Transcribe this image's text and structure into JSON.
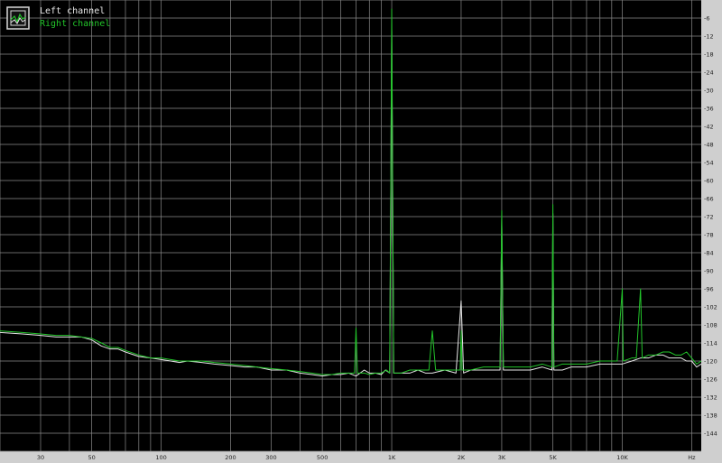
{
  "colors": {
    "background": "#000000",
    "grid": "#8a8a8a",
    "frame": "#cfcfcf",
    "left_channel": "#e6e6e6",
    "right_channel": "#22c42a"
  },
  "legend": {
    "icon": "spectrum-icon",
    "items": [
      {
        "label": "Left channel",
        "color": "#e6e6e6"
      },
      {
        "label": "Right channel",
        "color": "#22c42a"
      }
    ]
  },
  "chart_data": {
    "type": "line",
    "title": "",
    "xlabel": "",
    "ylabel": "",
    "x_scale": "log",
    "xlim": [
      20,
      22000
    ],
    "ylim": [
      -150,
      0
    ],
    "x_unit": "Hz",
    "grid": true,
    "legend_position": "top-left",
    "x_ticks": [
      {
        "value": 30,
        "label": "30"
      },
      {
        "value": 50,
        "label": "50"
      },
      {
        "value": 100,
        "label": "100"
      },
      {
        "value": 200,
        "label": "200"
      },
      {
        "value": 300,
        "label": "300"
      },
      {
        "value": 500,
        "label": "500"
      },
      {
        "value": 1000,
        "label": "1K"
      },
      {
        "value": 2000,
        "label": "2K"
      },
      {
        "value": 3000,
        "label": "3K"
      },
      {
        "value": 5000,
        "label": "5K"
      },
      {
        "value": 10000,
        "label": "10K"
      },
      {
        "value": 20000,
        "label": "Hz"
      }
    ],
    "y_ticks": [
      {
        "value": -6,
        "label": "-6"
      },
      {
        "value": -12,
        "label": "-12"
      },
      {
        "value": -18,
        "label": "-18"
      },
      {
        "value": -24,
        "label": "-24"
      },
      {
        "value": -30,
        "label": "-30"
      },
      {
        "value": -36,
        "label": "-36"
      },
      {
        "value": -42,
        "label": "-42"
      },
      {
        "value": -48,
        "label": "-48"
      },
      {
        "value": -54,
        "label": "-54"
      },
      {
        "value": -60,
        "label": "-60"
      },
      {
        "value": -66,
        "label": "-66"
      },
      {
        "value": -72,
        "label": "-72"
      },
      {
        "value": -78,
        "label": "-78"
      },
      {
        "value": -84,
        "label": "-84"
      },
      {
        "value": -90,
        "label": "-90"
      },
      {
        "value": -96,
        "label": "-96"
      },
      {
        "value": -102,
        "label": "-102"
      },
      {
        "value": -108,
        "label": "-108"
      },
      {
        "value": -114,
        "label": "-114"
      },
      {
        "value": -120,
        "label": "-120"
      },
      {
        "value": -126,
        "label": "-126"
      },
      {
        "value": -132,
        "label": "-132"
      },
      {
        "value": -138,
        "label": "-138"
      },
      {
        "value": -144,
        "label": "-144"
      }
    ],
    "series": [
      {
        "name": "Left channel",
        "color": "#e6e6e6",
        "points": [
          [
            20,
            -110.5
          ],
          [
            25,
            -111
          ],
          [
            30,
            -111.5
          ],
          [
            35,
            -112
          ],
          [
            40,
            -112
          ],
          [
            45,
            -112
          ],
          [
            50,
            -113
          ],
          [
            55,
            -115
          ],
          [
            60,
            -116
          ],
          [
            65,
            -116
          ],
          [
            70,
            -117
          ],
          [
            80,
            -118.5
          ],
          [
            90,
            -119
          ],
          [
            100,
            -119.5
          ],
          [
            110,
            -120
          ],
          [
            120,
            -120.5
          ],
          [
            130,
            -120
          ],
          [
            150,
            -120.5
          ],
          [
            170,
            -121
          ],
          [
            200,
            -121.5
          ],
          [
            230,
            -122
          ],
          [
            260,
            -122
          ],
          [
            300,
            -123
          ],
          [
            350,
            -123
          ],
          [
            400,
            -124
          ],
          [
            450,
            -124.5
          ],
          [
            500,
            -125
          ],
          [
            550,
            -124.5
          ],
          [
            600,
            -124.5
          ],
          [
            650,
            -124
          ],
          [
            700,
            -125
          ],
          [
            760,
            -123
          ],
          [
            800,
            -124
          ],
          [
            850,
            -124
          ],
          [
            900,
            -124.5
          ],
          [
            940,
            -123
          ],
          [
            980,
            -124
          ],
          [
            1000,
            -10
          ],
          [
            1020,
            -124
          ],
          [
            1100,
            -124
          ],
          [
            1200,
            -124
          ],
          [
            1300,
            -123
          ],
          [
            1400,
            -124
          ],
          [
            1500,
            -124
          ],
          [
            1700,
            -123
          ],
          [
            1900,
            -124
          ],
          [
            2000,
            -100
          ],
          [
            2050,
            -124
          ],
          [
            2200,
            -123
          ],
          [
            2500,
            -123
          ],
          [
            2800,
            -123
          ],
          [
            2950,
            -123
          ],
          [
            3000,
            -73
          ],
          [
            3050,
            -123
          ],
          [
            3300,
            -123
          ],
          [
            3600,
            -123
          ],
          [
            4000,
            -123
          ],
          [
            4500,
            -122
          ],
          [
            4950,
            -123
          ],
          [
            5000,
            -71
          ],
          [
            5050,
            -123
          ],
          [
            5500,
            -123
          ],
          [
            6000,
            -122
          ],
          [
            7000,
            -122
          ],
          [
            8000,
            -121
          ],
          [
            9000,
            -121
          ],
          [
            10000,
            -121
          ],
          [
            11000,
            -120
          ],
          [
            12000,
            -119
          ],
          [
            13000,
            -119
          ],
          [
            14000,
            -118
          ],
          [
            15000,
            -118
          ],
          [
            16000,
            -119
          ],
          [
            17000,
            -119
          ],
          [
            18000,
            -119
          ],
          [
            19000,
            -120
          ],
          [
            20000,
            -120
          ],
          [
            21000,
            -122
          ],
          [
            22000,
            -121
          ]
        ],
        "peaks_dB": [
          {
            "freq": 1000,
            "level": -10
          },
          {
            "freq": 2000,
            "level": -100
          },
          {
            "freq": 3000,
            "level": -73
          },
          {
            "freq": 5000,
            "level": -71
          }
        ]
      },
      {
        "name": "Right channel",
        "color": "#22c42a",
        "points": [
          [
            20,
            -110
          ],
          [
            25,
            -110.5
          ],
          [
            30,
            -111
          ],
          [
            35,
            -111.5
          ],
          [
            40,
            -111.5
          ],
          [
            45,
            -112
          ],
          [
            50,
            -112.5
          ],
          [
            55,
            -114
          ],
          [
            60,
            -115.5
          ],
          [
            65,
            -115.5
          ],
          [
            70,
            -116.5
          ],
          [
            80,
            -118
          ],
          [
            90,
            -119
          ],
          [
            100,
            -119
          ],
          [
            110,
            -119.5
          ],
          [
            120,
            -120
          ],
          [
            130,
            -120
          ],
          [
            150,
            -120
          ],
          [
            170,
            -120.5
          ],
          [
            200,
            -121
          ],
          [
            230,
            -121.5
          ],
          [
            260,
            -122
          ],
          [
            300,
            -122.5
          ],
          [
            350,
            -123
          ],
          [
            400,
            -123.5
          ],
          [
            450,
            -124
          ],
          [
            500,
            -124.5
          ],
          [
            550,
            -124.5
          ],
          [
            600,
            -124
          ],
          [
            650,
            -124
          ],
          [
            690,
            -124
          ],
          [
            700,
            -109
          ],
          [
            710,
            -124
          ],
          [
            760,
            -124
          ],
          [
            800,
            -124.5
          ],
          [
            850,
            -124
          ],
          [
            900,
            -124
          ],
          [
            950,
            -123
          ],
          [
            980,
            -124
          ],
          [
            1000,
            -3
          ],
          [
            1020,
            -124
          ],
          [
            1100,
            -124
          ],
          [
            1200,
            -123
          ],
          [
            1300,
            -123
          ],
          [
            1400,
            -123
          ],
          [
            1450,
            -123
          ],
          [
            1500,
            -110
          ],
          [
            1550,
            -123
          ],
          [
            1700,
            -123
          ],
          [
            1900,
            -123
          ],
          [
            1980,
            -123
          ],
          [
            2000,
            -110
          ],
          [
            2020,
            -123
          ],
          [
            2200,
            -123
          ],
          [
            2500,
            -122
          ],
          [
            2800,
            -122
          ],
          [
            2950,
            -122
          ],
          [
            3000,
            -70
          ],
          [
            3050,
            -122
          ],
          [
            3300,
            -122
          ],
          [
            3600,
            -122
          ],
          [
            4000,
            -122
          ],
          [
            4500,
            -121
          ],
          [
            4950,
            -122
          ],
          [
            5000,
            -68
          ],
          [
            5050,
            -122
          ],
          [
            5500,
            -121
          ],
          [
            6000,
            -121
          ],
          [
            7000,
            -121
          ],
          [
            8000,
            -120
          ],
          [
            9000,
            -120
          ],
          [
            9500,
            -120
          ],
          [
            10000,
            -96
          ],
          [
            10100,
            -120
          ],
          [
            11000,
            -119
          ],
          [
            11500,
            -119
          ],
          [
            12000,
            -96
          ],
          [
            12200,
            -119
          ],
          [
            13000,
            -118
          ],
          [
            14000,
            -118
          ],
          [
            15000,
            -117
          ],
          [
            16000,
            -117
          ],
          [
            17000,
            -118
          ],
          [
            18000,
            -118
          ],
          [
            19000,
            -117
          ],
          [
            20000,
            -119
          ],
          [
            21000,
            -121
          ],
          [
            22000,
            -120
          ]
        ],
        "peaks_dB": [
          {
            "freq": 700,
            "level": -109
          },
          {
            "freq": 1000,
            "level": -3
          },
          {
            "freq": 1500,
            "level": -110
          },
          {
            "freq": 2000,
            "level": -110
          },
          {
            "freq": 3000,
            "level": -70
          },
          {
            "freq": 5000,
            "level": -68
          },
          {
            "freq": 10000,
            "level": -96
          },
          {
            "freq": 12000,
            "level": -96
          }
        ]
      }
    ]
  }
}
